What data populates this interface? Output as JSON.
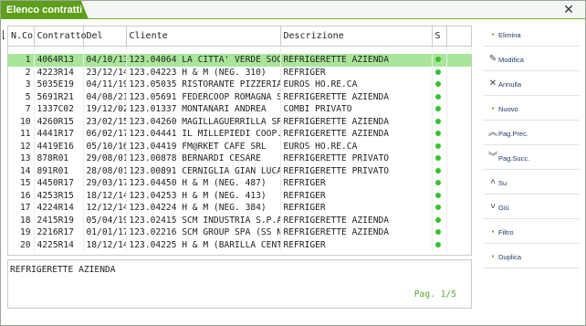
{
  "window": {
    "title": "Elenco contratti",
    "close_glyph": "✕"
  },
  "table": {
    "columns": [
      "N.Co",
      "Contratto",
      "Del",
      "Cliente",
      "Descrizione",
      "S"
    ],
    "rows": [
      {
        "nco": "1",
        "contratto": "4064R13",
        "del": "04/10/13",
        "cliente": "123.04064 LA CITTA' VERDE SOC",
        "descrizione": "REFRIGERETTE AZIENDA",
        "status": "green"
      },
      {
        "nco": "2",
        "contratto": "4223R14",
        "del": "23/12/14",
        "cliente": "123.04223 H & M (NEG. 310)",
        "descrizione": "REFRIGER",
        "status": "green"
      },
      {
        "nco": "3",
        "contratto": "5035E19",
        "del": "04/11/19",
        "cliente": "123.05035 RISTORANTE PIZZERIA",
        "descrizione": "EUROS HO.RE.CA",
        "status": "green"
      },
      {
        "nco": "5",
        "contratto": "5691R21",
        "del": "04/08/21",
        "cliente": "123.05691 FEDERCOOP ROMAGNA S",
        "descrizione": "REFRIGERETTE AZIENDA",
        "status": "green"
      },
      {
        "nco": "7",
        "contratto": "1337C02",
        "del": "19/12/02",
        "cliente": "123.01337 MONTANARI ANDREA",
        "descrizione": "COMBI PRIVATO",
        "status": "green"
      },
      {
        "nco": "10",
        "contratto": "4260R15",
        "del": "23/02/15",
        "cliente": "123.04260 MAGILLAGUERRILLA SR",
        "descrizione": "REFRIGERETTE AZIENDA",
        "status": "green"
      },
      {
        "nco": "11",
        "contratto": "4441R17",
        "del": "06/02/17",
        "cliente": "123.04441 IL MILLEPIEDI COOP.",
        "descrizione": "REFRIGERETTE AZIENDA",
        "status": "green"
      },
      {
        "nco": "12",
        "contratto": "4419E16",
        "del": "05/10/16",
        "cliente": "123.04419 FM@RKET CAFE SRL",
        "descrizione": "EUROS HO.RE.CA",
        "status": "green"
      },
      {
        "nco": "13",
        "contratto": "878R01",
        "del": "29/08/01",
        "cliente": "123.00878 BERNARDI CESARE",
        "descrizione": "REFRIGERETTE PRIVATO",
        "status": "green"
      },
      {
        "nco": "14",
        "contratto": "891R01",
        "del": "28/08/01",
        "cliente": "123.00891 CERNIGLIA GIAN LUCA",
        "descrizione": "REFRIGERETTE PRIVATO",
        "status": "green"
      },
      {
        "nco": "15",
        "contratto": "4450R17",
        "del": "29/03/17",
        "cliente": "123.04450 H & M (NEG. 487)",
        "descrizione": "REFRIGER",
        "status": "green"
      },
      {
        "nco": "16",
        "contratto": "4253R15",
        "del": "18/12/14",
        "cliente": "123.04253 H & M (NEG. 413)",
        "descrizione": "REFRIGER",
        "status": "green"
      },
      {
        "nco": "17",
        "contratto": "4224R14",
        "del": "12/12/14",
        "cliente": "123.04224 H & M (NEG. 384)",
        "descrizione": "REFRIGER",
        "status": "green"
      },
      {
        "nco": "18",
        "contratto": "2415R19",
        "del": "05/04/19",
        "cliente": "123.02415 SCM INDUSTRIA S.P.A",
        "descrizione": "REFRIGERETTE AZIENDA",
        "status": "green"
      },
      {
        "nco": "19",
        "contratto": "2216R17",
        "del": "01/01/17",
        "cliente": "123.02216 SCM GROUP SPA (SS N",
        "descrizione": "REFRIGERETTE AZIENDA",
        "status": "green"
      },
      {
        "nco": "20",
        "contratto": "4225R14",
        "del": "18/12/14",
        "cliente": "123.04225 H & M (BARILLA CENT",
        "descrizione": "REFRIGER",
        "status": "green"
      }
    ],
    "selected_index": 0
  },
  "detail": {
    "description": "REFRIGERETTE AZIENDA",
    "page_indicator": "Pag. 1/5"
  },
  "sidebar": {
    "buttons": [
      {
        "label": "Elimina",
        "icon": "green-dot-icon"
      },
      {
        "label": "Modifica",
        "icon": "edit-icon"
      },
      {
        "label": "Annulla",
        "icon": "cancel-icon"
      },
      {
        "label": "Nuovo",
        "icon": "green-dot-icon"
      },
      {
        "label": "Pag.Prec.",
        "icon": "double-chevron-up-icon"
      },
      {
        "label": "Pag.Succ.",
        "icon": "double-chevron-down-icon"
      },
      {
        "label": "Su",
        "icon": "chevron-up-icon"
      },
      {
        "label": "Giù",
        "icon": "chevron-down-icon"
      },
      {
        "label": "Filtro",
        "icon": "green-dot-icon"
      },
      {
        "label": "Duplica",
        "icon": "green-dot-icon"
      }
    ]
  },
  "colors": {
    "title_bar": "#5e9f1a",
    "selected_row": "#a9e69a",
    "status_ok": "#33c22c",
    "page_indicator": "#58a83a"
  }
}
